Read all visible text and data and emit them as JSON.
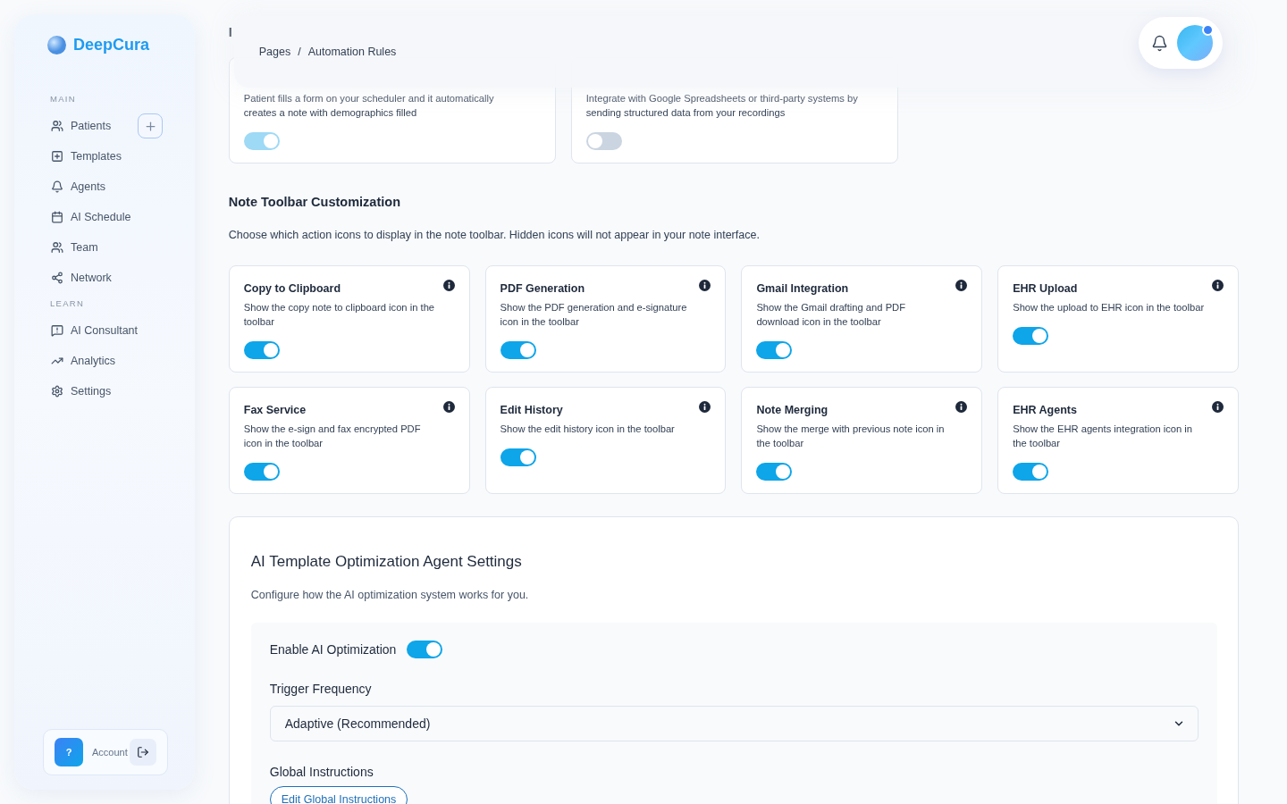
{
  "brand": {
    "name": "DeepCura"
  },
  "sidebar": {
    "sections": [
      {
        "heading": "MAIN",
        "items": [
          {
            "label": "Patients",
            "has_add": true
          },
          {
            "label": "Templates",
            "has_add": false
          },
          {
            "label": "Agents",
            "has_add": false
          },
          {
            "label": "AI Schedule",
            "has_add": false
          },
          {
            "label": "Team",
            "has_add": false
          },
          {
            "label": "Network",
            "has_add": false
          }
        ]
      },
      {
        "heading": "LEARN",
        "items": [
          {
            "label": "AI Consultant",
            "has_add": false
          },
          {
            "label": "Analytics",
            "has_add": false
          },
          {
            "label": "Settings",
            "has_add": false
          }
        ]
      }
    ]
  },
  "account": {
    "avatar": "?",
    "label": "Account"
  },
  "header": {
    "breadcrumb": [
      "Pages",
      "Automation Rules"
    ],
    "separator": "/"
  },
  "integrations": {
    "title": "I",
    "cards": [
      {
        "description": "Patient fills a form on your scheduler and it automatically creates a note with demographics filled",
        "on": true,
        "disabled": true
      },
      {
        "description": "Integrate with Google Spreadsheets or third-party systems by sending structured data from your recordings",
        "on": false,
        "disabled": false
      }
    ]
  },
  "toolbar": {
    "title": "Note Toolbar Customization",
    "description": "Choose which action icons to display in the note toolbar. Hidden icons will not appear in your note interface.",
    "items": [
      {
        "title": "Copy to Clipboard",
        "description": "Show the copy note to clipboard icon in the toolbar",
        "on": true
      },
      {
        "title": "PDF Generation",
        "description": "Show the PDF generation and e-signature icon in the toolbar",
        "on": true
      },
      {
        "title": "Gmail Integration",
        "description": "Show the Gmail drafting and PDF download icon in the toolbar",
        "on": true
      },
      {
        "title": "EHR Upload",
        "description": "Show the upload to EHR icon in the toolbar",
        "on": true
      },
      {
        "title": "Fax Service",
        "description": "Show the e-sign and fax encrypted PDF icon in the toolbar",
        "on": true
      },
      {
        "title": "Edit History",
        "description": "Show the edit history icon in the toolbar",
        "on": true
      },
      {
        "title": "Note Merging",
        "description": "Show the merge with previous note icon in the toolbar",
        "on": true
      },
      {
        "title": "EHR Agents",
        "description": "Show the EHR agents integration icon in the toolbar",
        "on": true
      }
    ]
  },
  "optimization": {
    "title": "AI Template Optimization Agent Settings",
    "description": "Configure how the AI optimization system works for you.",
    "enable": {
      "label": "Enable AI Optimization",
      "on": true
    },
    "trigger": {
      "label": "Trigger Frequency",
      "value": "Adaptive (Recommended)"
    },
    "global": {
      "label": "Global Instructions",
      "button": "Edit Global Instructions"
    }
  }
}
